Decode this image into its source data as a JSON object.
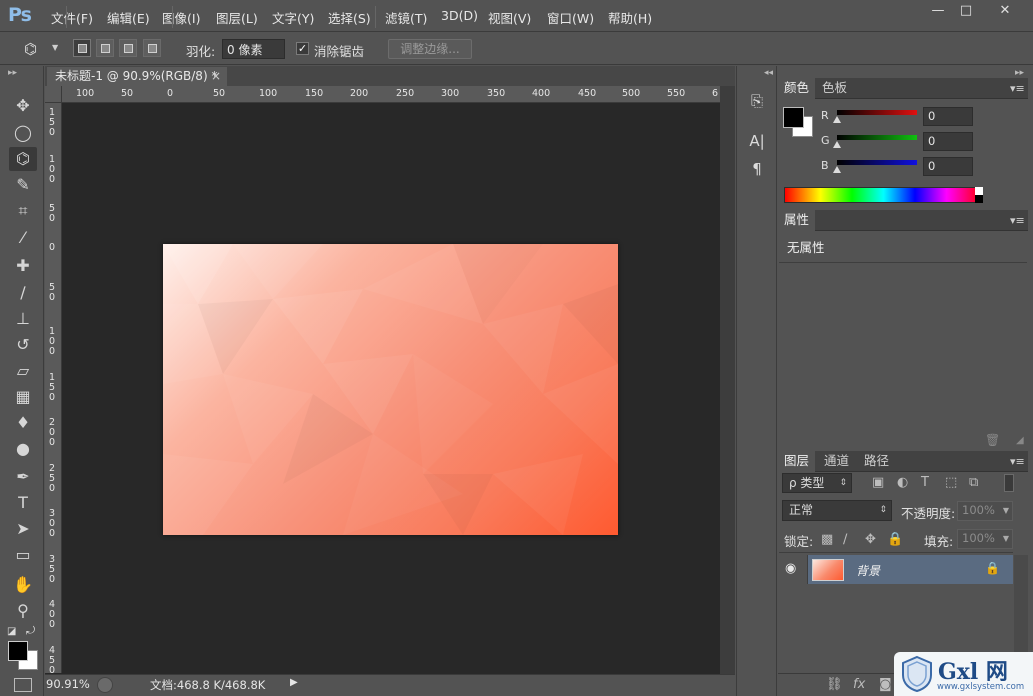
{
  "app": {
    "logo": "Ps",
    "menus": [
      "文件(F)",
      "编辑(E)",
      "图像(I)",
      "图层(L)",
      "文字(Y)",
      "选择(S)",
      "滤镜(T)",
      "3D(D)",
      "视图(V)",
      "窗口(W)",
      "帮助(H)"
    ],
    "window_buttons": {
      "minimize": "—",
      "maximize": "□",
      "close": "✕"
    }
  },
  "options_bar": {
    "feather_label": "羽化:",
    "feather_value": "0 像素",
    "antialias_label": "消除锯齿",
    "antialias_checked": true,
    "refine_edge_label": "调整边缘..."
  },
  "tools": [
    {
      "name": "move-tool",
      "glyph": "✥"
    },
    {
      "name": "elliptical-marquee-tool",
      "glyph": "◯"
    },
    {
      "name": "polygonal-lasso-tool",
      "glyph": "⌬",
      "active": true
    },
    {
      "name": "quick-selection-tool",
      "glyph": "✎"
    },
    {
      "name": "crop-tool",
      "glyph": "⌗"
    },
    {
      "name": "eyedropper-tool",
      "glyph": "⁄"
    },
    {
      "name": "spot-healing-tool",
      "glyph": "✚"
    },
    {
      "name": "brush-tool",
      "glyph": "∕"
    },
    {
      "name": "clone-stamp-tool",
      "glyph": "⊥"
    },
    {
      "name": "history-brush-tool",
      "glyph": "↺"
    },
    {
      "name": "eraser-tool",
      "glyph": "▱"
    },
    {
      "name": "gradient-tool",
      "glyph": "▦"
    },
    {
      "name": "blur-tool",
      "glyph": "♦"
    },
    {
      "name": "dodge-tool",
      "glyph": "●"
    },
    {
      "name": "pen-tool",
      "glyph": "✒"
    },
    {
      "name": "type-tool",
      "glyph": "T"
    },
    {
      "name": "path-selection-tool",
      "glyph": "➤"
    },
    {
      "name": "rectangle-tool",
      "glyph": "▭"
    },
    {
      "name": "hand-tool",
      "glyph": "✋"
    },
    {
      "name": "zoom-tool",
      "glyph": "⚲"
    }
  ],
  "document": {
    "tab_title": "未标题-1 @ 90.9%(RGB/8) *",
    "tab_close": "×",
    "ruler_h": [
      "100",
      "50",
      "0",
      "50",
      "100",
      "150",
      "200",
      "250",
      "300",
      "350",
      "400",
      "450",
      "500",
      "550",
      "6"
    ],
    "ruler_v": [
      "1\n5\n0",
      "1\n0\n0",
      "5\n0",
      "0",
      "5\n0",
      "1\n0\n0",
      "1\n5\n0",
      "2\n0\n0",
      "2\n5\n0",
      "3\n0\n0",
      "3\n5\n0",
      "4\n0\n0",
      "4\n5\n0",
      "5\n0\n0"
    ],
    "zoom": "90.91%",
    "doc_size": "文档:468.8 K/468.8K",
    "canvas_colors": [
      "#fff1ec",
      "#ff5a30"
    ]
  },
  "color_panel": {
    "tabs": [
      "颜色",
      "色板"
    ],
    "channels": [
      {
        "label": "R",
        "value": "0",
        "color": "#e01010"
      },
      {
        "label": "G",
        "value": "0",
        "color": "#10c010"
      },
      {
        "label": "B",
        "value": "0",
        "color": "#1010e0"
      }
    ],
    "foreground": "#000000",
    "background": "#ffffff"
  },
  "properties_panel": {
    "tab": "属性",
    "content": "无属性"
  },
  "layers_panel": {
    "tabs": [
      "图层",
      "通道",
      "路径"
    ],
    "filter_label": "ρ 类型",
    "blend_mode": "正常",
    "opacity_label": "不透明度:",
    "opacity_value": "100%",
    "lock_label": "锁定:",
    "fill_label": "填充:",
    "fill_value": "100%",
    "layers": [
      {
        "name": "背景",
        "locked": true,
        "visible": true
      }
    ]
  },
  "watermark": {
    "brand": "Gxl 网",
    "url": "www.gxlsystem.com"
  }
}
